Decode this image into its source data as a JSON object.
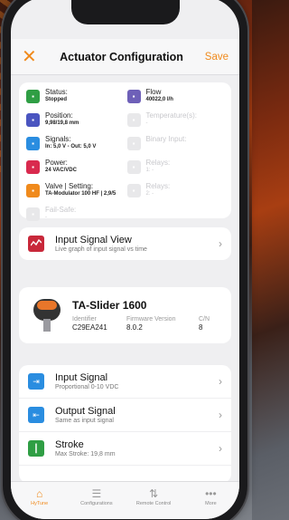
{
  "header": {
    "close_glyph": "✕",
    "title": "Actuator Configuration",
    "save_label": "Save"
  },
  "status": {
    "items": [
      {
        "label": "Status:",
        "value": "Stopped",
        "icon": "sliders-icon",
        "color": "#2f9e44",
        "active": true
      },
      {
        "label": "Flow",
        "value": "40022,0 l/h",
        "icon": "flow-icon",
        "color": "#6e60b8",
        "active": true
      },
      {
        "label": "Position:",
        "value": "9,98/19,8 mm",
        "icon": "position-icon",
        "color": "#4a55c0",
        "active": true
      },
      {
        "label": "Temperature(s):",
        "value": "-",
        "icon": "temperature-icon",
        "color": "#e8e8ea",
        "active": false
      },
      {
        "label": "Signals:",
        "value": "In: 5,0 V - Out: 5,0 V",
        "icon": "signal-icon",
        "color": "#2a8de0",
        "active": true
      },
      {
        "label": "Binary Input:",
        "value": "",
        "icon": "binary-input-icon",
        "color": "#e8e8ea",
        "active": false
      },
      {
        "label": "Power:",
        "value": "24 VAC/VDC",
        "icon": "power-icon",
        "color": "#d92a4e",
        "active": true
      },
      {
        "label": "Relays:",
        "value": "1: -",
        "icon": "relay-icon",
        "color": "#e8e8ea",
        "active": false
      },
      {
        "label": "Valve | Setting:",
        "value": "TA-Modulator 100 HF | 2,9/5",
        "icon": "valve-icon",
        "color": "#f08a1c",
        "active": true
      },
      {
        "label": "Relays:",
        "value": "2: -",
        "icon": "relay-icon",
        "color": "#e8e8ea",
        "active": false
      },
      {
        "label": "Fail-Safe:",
        "value": "-",
        "icon": "fail-safe-icon",
        "color": "#e8e8ea",
        "active": false
      }
    ]
  },
  "input_signal_view": {
    "title": "Input Signal View",
    "subtitle": "Live graph of input signal vs time"
  },
  "device": {
    "name": "TA-Slider 1600",
    "headers": [
      "Identifier",
      "Firmware Version",
      "C/N"
    ],
    "values": [
      "C29EA241",
      "8.0.2",
      "8"
    ]
  },
  "settings": [
    {
      "title": "Input Signal",
      "subtitle": "Proportional 0-10 VDC",
      "icon": "input-signal-icon",
      "color": "#2a8de0"
    },
    {
      "title": "Output Signal",
      "subtitle": "Same as input signal",
      "icon": "output-signal-icon",
      "color": "#2a8de0"
    },
    {
      "title": "Stroke",
      "subtitle": "Max Stroke: 19,8 mm",
      "icon": "stroke-icon",
      "color": "#2f9e44"
    }
  ],
  "tabs": [
    {
      "label": "HyTune",
      "icon": "home-icon",
      "glyph": "⌂",
      "active": true
    },
    {
      "label": "Configurations",
      "icon": "list-icon",
      "glyph": "☰",
      "active": false
    },
    {
      "label": "Remote Control",
      "icon": "remote-icon",
      "glyph": "⇅",
      "active": false
    },
    {
      "label": "More",
      "icon": "more-icon",
      "glyph": "•••",
      "active": false
    }
  ]
}
